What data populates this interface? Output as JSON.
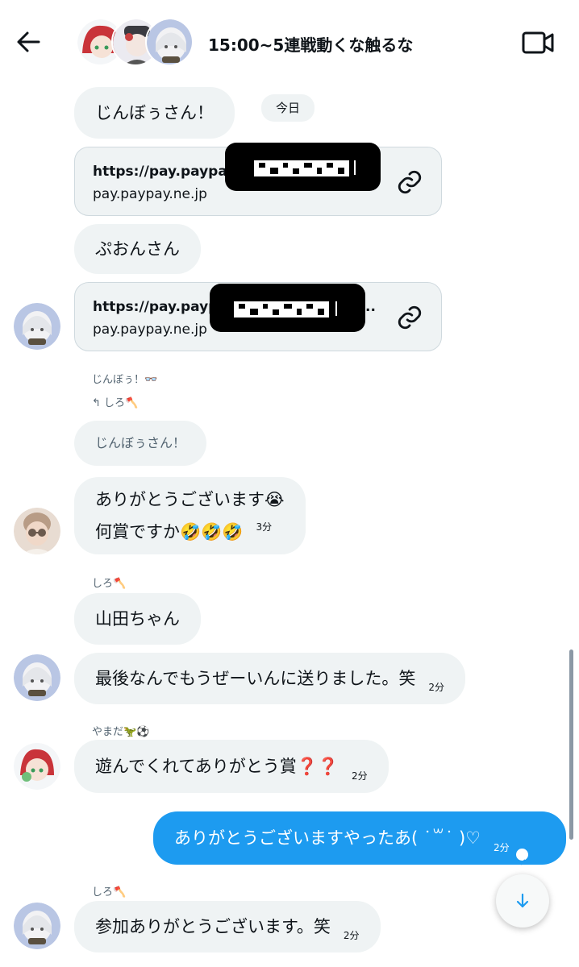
{
  "header": {
    "title": "15:00~5連戦動くな触るな",
    "back_icon": "arrow-left-icon",
    "video_icon": "video-camera-icon"
  },
  "date_chip": "今日",
  "messages": {
    "m1": {
      "text": "じんぼぅさん！"
    },
    "link1": {
      "url": "https://pay.paypay",
      "domain": "pay.paypay.ne.jp",
      "redacted_text": "「黒塗り」"
    },
    "m2": {
      "text": "ぷおんさん"
    },
    "link2": {
      "url": "https://pay.paypay",
      "url_tail": "..",
      "domain": "pay.paypay.ne.jp",
      "redacted_text": "「黒塗り」"
    },
    "m3": {
      "sender": "じんぼぅ！👓",
      "reply_to": "↰ しろ🪓",
      "reply_text": "じんぼぅさん！",
      "line1": "ありがとうございます😭",
      "line2": "何賞ですか🤣🤣🤣",
      "time": "3分"
    },
    "m4": {
      "sender": "しろ🪓",
      "text": "山田ちゃん"
    },
    "m5": {
      "text": "最後なんでもうぜーいんに送りました。笑",
      "time": "2分"
    },
    "m6": {
      "sender": "やまだ🦖⚽",
      "text": "遊んでくれてありがとう賞❓❓",
      "time": "2分"
    },
    "m7": {
      "text": "ありがとうございますやったあ( ˙꒳˙ )♡",
      "time": "2分"
    },
    "m8": {
      "sender": "しろ🪓",
      "text": "参加ありがとうございます。笑",
      "time": "2分"
    }
  },
  "colors": {
    "bubble_bg": "#eff3f4",
    "my_bubble_bg": "#1d9bf0",
    "text": "#0f1419",
    "muted": "#536471"
  },
  "scroll_down_icon": "arrow-down-icon"
}
